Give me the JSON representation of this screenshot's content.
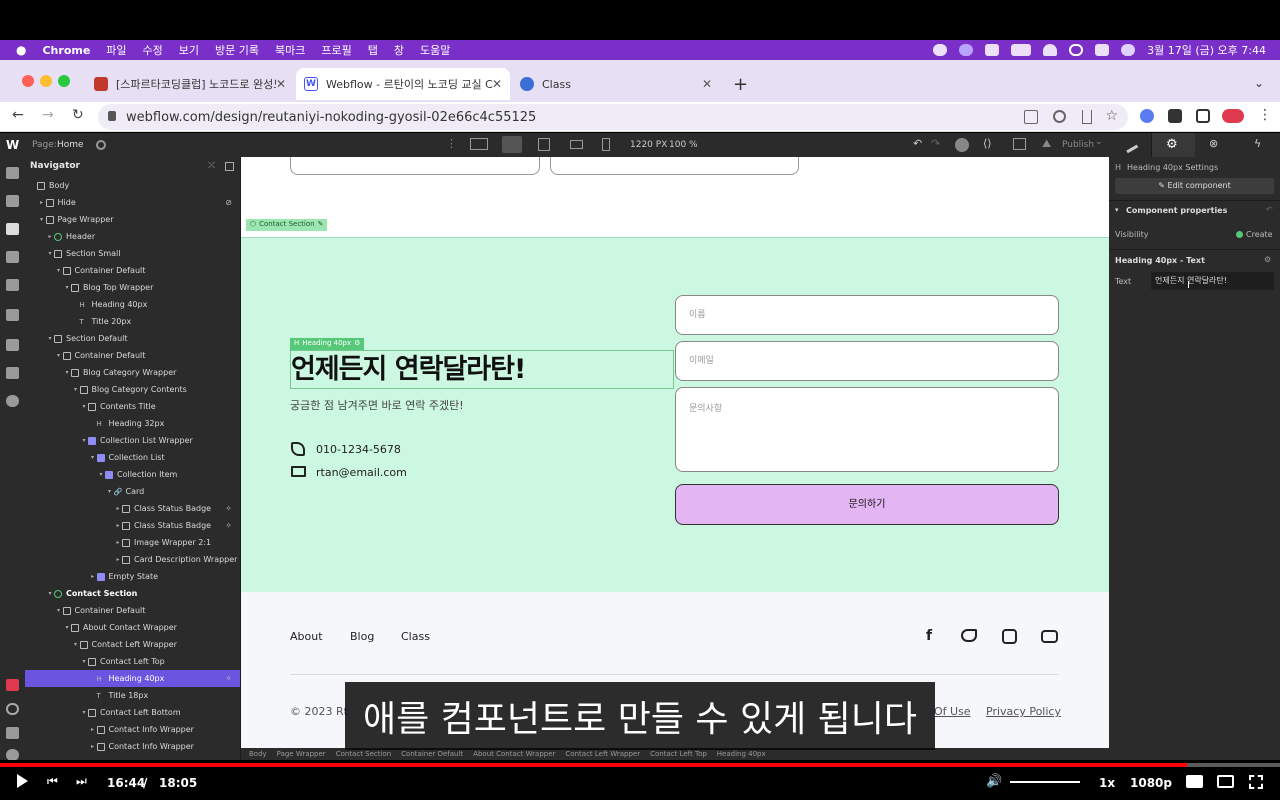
{
  "macos": {
    "apple": "",
    "app": "Chrome",
    "menus": [
      "파일",
      "수정",
      "보기",
      "방문 기록",
      "북마크",
      "프로필",
      "탭",
      "창",
      "도움말"
    ],
    "clock": "3월 17일 (금) 오후 7:44"
  },
  "browser": {
    "tabs": [
      {
        "label": "[스파르타코딩클럽] 노코드로 완성도",
        "fav_color": "#c0392b"
      },
      {
        "label": "Webflow - 르탄이의 노코딩 교실 C",
        "fav_color": "#4353ff"
      },
      {
        "label": "Class",
        "fav_color": "#3a6fd8"
      }
    ],
    "url": "webflow.com/design/reutaniyi-nokoding-gyosil-02e66c4c55125"
  },
  "webflow": {
    "page_label": "Page:",
    "page_name": "Home",
    "width_px": "1220 PX",
    "zoom": "100 %",
    "publish": "Publish"
  },
  "navigator": {
    "title": "Navigator",
    "rows": [
      {
        "label": "Body",
        "depth": 0,
        "caret": "",
        "icon": "box"
      },
      {
        "label": "Hide",
        "depth": 1,
        "caret": "▸",
        "icon": "box",
        "pin": "⊘"
      },
      {
        "label": "Page Wrapper",
        "depth": 1,
        "caret": "▾",
        "icon": "box"
      },
      {
        "label": "Header",
        "depth": 2,
        "caret": "▸",
        "icon": "comp"
      },
      {
        "label": "Section Small",
        "depth": 2,
        "caret": "▾",
        "icon": "box"
      },
      {
        "label": "Container Default",
        "depth": 3,
        "caret": "▾",
        "icon": "box"
      },
      {
        "label": "Blog Top Wrapper",
        "depth": 4,
        "caret": "▾",
        "icon": "box"
      },
      {
        "label": "Heading 40px",
        "depth": 5,
        "caret": "",
        "icon": "H"
      },
      {
        "label": "Title 20px",
        "depth": 5,
        "caret": "",
        "icon": "T"
      },
      {
        "label": "Section Default",
        "depth": 2,
        "caret": "▾",
        "icon": "box"
      },
      {
        "label": "Container Default",
        "depth": 3,
        "caret": "▾",
        "icon": "box"
      },
      {
        "label": "Blog Category Wrapper",
        "depth": 4,
        "caret": "▾",
        "icon": "box"
      },
      {
        "label": "Blog Category Contents",
        "depth": 5,
        "caret": "▾",
        "icon": "box"
      },
      {
        "label": "Contents Title",
        "depth": 6,
        "caret": "▾",
        "icon": "box"
      },
      {
        "label": "Heading 32px",
        "depth": 7,
        "caret": "",
        "icon": "H"
      },
      {
        "label": "Collection List Wrapper",
        "depth": 6,
        "caret": "▾",
        "icon": "coll"
      },
      {
        "label": "Collection List",
        "depth": 7,
        "caret": "▾",
        "icon": "coll"
      },
      {
        "label": "Collection Item",
        "depth": 8,
        "caret": "▾",
        "icon": "coll"
      },
      {
        "label": "Card",
        "depth": 9,
        "caret": "▾",
        "icon": "link"
      },
      {
        "label": "Class Status Badge",
        "depth": 10,
        "caret": "▸",
        "icon": "box",
        "pin": "✧"
      },
      {
        "label": "Class Status Badge",
        "depth": 10,
        "caret": "▸",
        "icon": "box",
        "pin": "✧"
      },
      {
        "label": "Image Wrapper 2:1",
        "depth": 10,
        "caret": "▸",
        "icon": "box"
      },
      {
        "label": "Card Description Wrapper",
        "depth": 10,
        "caret": "▸",
        "icon": "box"
      },
      {
        "label": "Empty State",
        "depth": 7,
        "caret": "▸",
        "icon": "coll"
      },
      {
        "label": "Contact Section",
        "depth": 2,
        "caret": "▾",
        "icon": "comp",
        "bold": true
      },
      {
        "label": "Container Default",
        "depth": 3,
        "caret": "▾",
        "icon": "box"
      },
      {
        "label": "About Contact Wrapper",
        "depth": 4,
        "caret": "▾",
        "icon": "box"
      },
      {
        "label": "Contact Left Wrapper",
        "depth": 5,
        "caret": "▾",
        "icon": "box"
      },
      {
        "label": "Contact Left Top",
        "depth": 6,
        "caret": "▾",
        "icon": "box"
      },
      {
        "label": "Heading 40px",
        "depth": 7,
        "caret": "",
        "icon": "H",
        "selected": true,
        "pin": "✧"
      },
      {
        "label": "Title 18px",
        "depth": 7,
        "caret": "",
        "icon": "T"
      },
      {
        "label": "Contact Left Bottom",
        "depth": 6,
        "caret": "▾",
        "icon": "box"
      },
      {
        "label": "Contact Info Wrapper",
        "depth": 7,
        "caret": "▸",
        "icon": "box"
      },
      {
        "label": "Contact Info Wrapper",
        "depth": 7,
        "caret": "▸",
        "icon": "box"
      }
    ]
  },
  "canvas": {
    "section_tag": "Contact Section",
    "heading_tag": "Heading 40px",
    "heading": "언제든지 연락달라탄!",
    "subtitle": "궁금한 점 남겨주면 바로 연락 주겠탄!",
    "phone": "010-1234-5678",
    "email": "rtan@email.com",
    "form": {
      "name_placeholder": "이름",
      "email_placeholder": "이메일",
      "message_placeholder": "문의사항",
      "submit": "문의하기"
    },
    "footer": {
      "links": [
        "About",
        "Blog",
        "Class"
      ],
      "copyright": "© 2023 Rt",
      "terms": "Of Use",
      "privacy": "Privacy Policy"
    },
    "colors": {
      "section_bg": "#ccf8e2",
      "submit_bg": "#e3b6f3",
      "footer_bg": "#f6f7fa"
    }
  },
  "right_panel": {
    "settings_title": "Heading 40px Settings",
    "edit_component": "Edit component",
    "component_properties": "Component properties",
    "visibility_label": "Visibility",
    "visibility_value": "Create",
    "heading_text_title": "Heading 40px - Text",
    "text_label": "Text",
    "text_value": "언제든지 연락달라탄!"
  },
  "breadcrumbs": [
    "Body",
    "Page Wrapper",
    "Contact Section",
    "Container Default",
    "About Contact Wrapper",
    "Contact Left Wrapper",
    "Contact Left Top",
    "Heading 40px"
  ],
  "subtitle_caption": "애를 컴포넌트로 만들 수 있게 됩니다",
  "player": {
    "current": "16:44",
    "separator": "/",
    "duration": "18:05",
    "speed": "1x",
    "quality": "1080p",
    "progress": 0.927
  }
}
